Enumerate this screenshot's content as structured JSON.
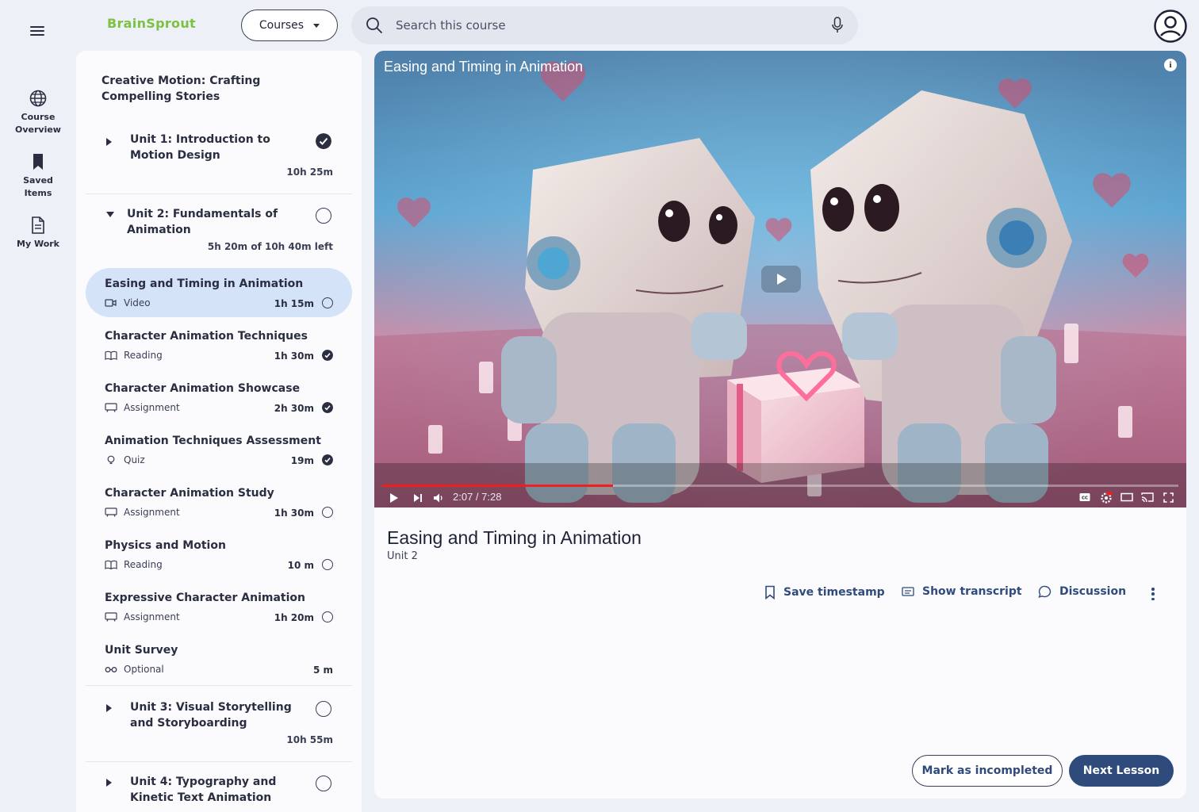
{
  "app": {
    "brand": "BrainSprout",
    "accent": "#2f4b7c",
    "brand_color": "#7cc241"
  },
  "topbar": {
    "courses_label": "Courses",
    "search_placeholder": "Search this course"
  },
  "rail": [
    {
      "label_1": "Course",
      "label_2": "Overview",
      "icon": "globe-icon"
    },
    {
      "label_1": "Saved",
      "label_2": "Items",
      "icon": "bookmark-icon"
    },
    {
      "label_1": "My Work",
      "icon": "document-icon"
    }
  ],
  "syllabus": {
    "course_title": "Creative Motion: Crafting Compelling Stories",
    "units": [
      {
        "title": "Unit 1: Introduction to Motion Design",
        "time": "10h 25m",
        "completed": true,
        "expanded": false
      },
      {
        "title": "Unit 2: Fundamentals of Animation",
        "time": "5h 20m of 10h 40m left",
        "completed": false,
        "expanded": true
      },
      {
        "title": "Unit 3: Visual Storytelling and Storyboarding",
        "time": "10h 55m",
        "completed": false,
        "expanded": false
      },
      {
        "title": "Unit 4: Typography and Kinetic Text Animation",
        "completed": false,
        "expanded": false
      }
    ],
    "lessons": [
      {
        "title": "Easing and Timing in Animation",
        "type": "Video",
        "duration": "1h 15m",
        "completed": false,
        "active": true
      },
      {
        "title": "Character Animation Techniques",
        "type": "Reading",
        "duration": "1h 30m",
        "completed": true
      },
      {
        "title": "Character Animation Showcase",
        "type": "Assignment",
        "duration": "2h 30m",
        "completed": true
      },
      {
        "title": "Animation Techniques Assessment",
        "type": "Quiz",
        "duration": "19m",
        "completed": true
      },
      {
        "title": "Character Animation Study",
        "type": "Assignment",
        "duration": "1h 30m",
        "completed": false
      },
      {
        "title": "Physics and Motion",
        "type": "Reading",
        "duration": "10 m",
        "completed": false
      },
      {
        "title": "Expressive Character Animation",
        "type": "Assignment",
        "duration": "1h 20m",
        "completed": false
      },
      {
        "title": "Unit Survey",
        "type": "Optional",
        "duration": "5 m",
        "completed": false
      }
    ]
  },
  "video": {
    "title": "Easing and Timing in Animation",
    "time_display": "2:07 / 7:28",
    "progress": 0.29
  },
  "lesson": {
    "title": "Easing and Timing in Animation",
    "unit": "Unit 2",
    "actions": {
      "save": "Save timestamp",
      "transcript": "Show transcript",
      "discussion": "Discussion"
    },
    "mark_incomplete": "Mark as incompleted",
    "next": "Next Lesson"
  }
}
